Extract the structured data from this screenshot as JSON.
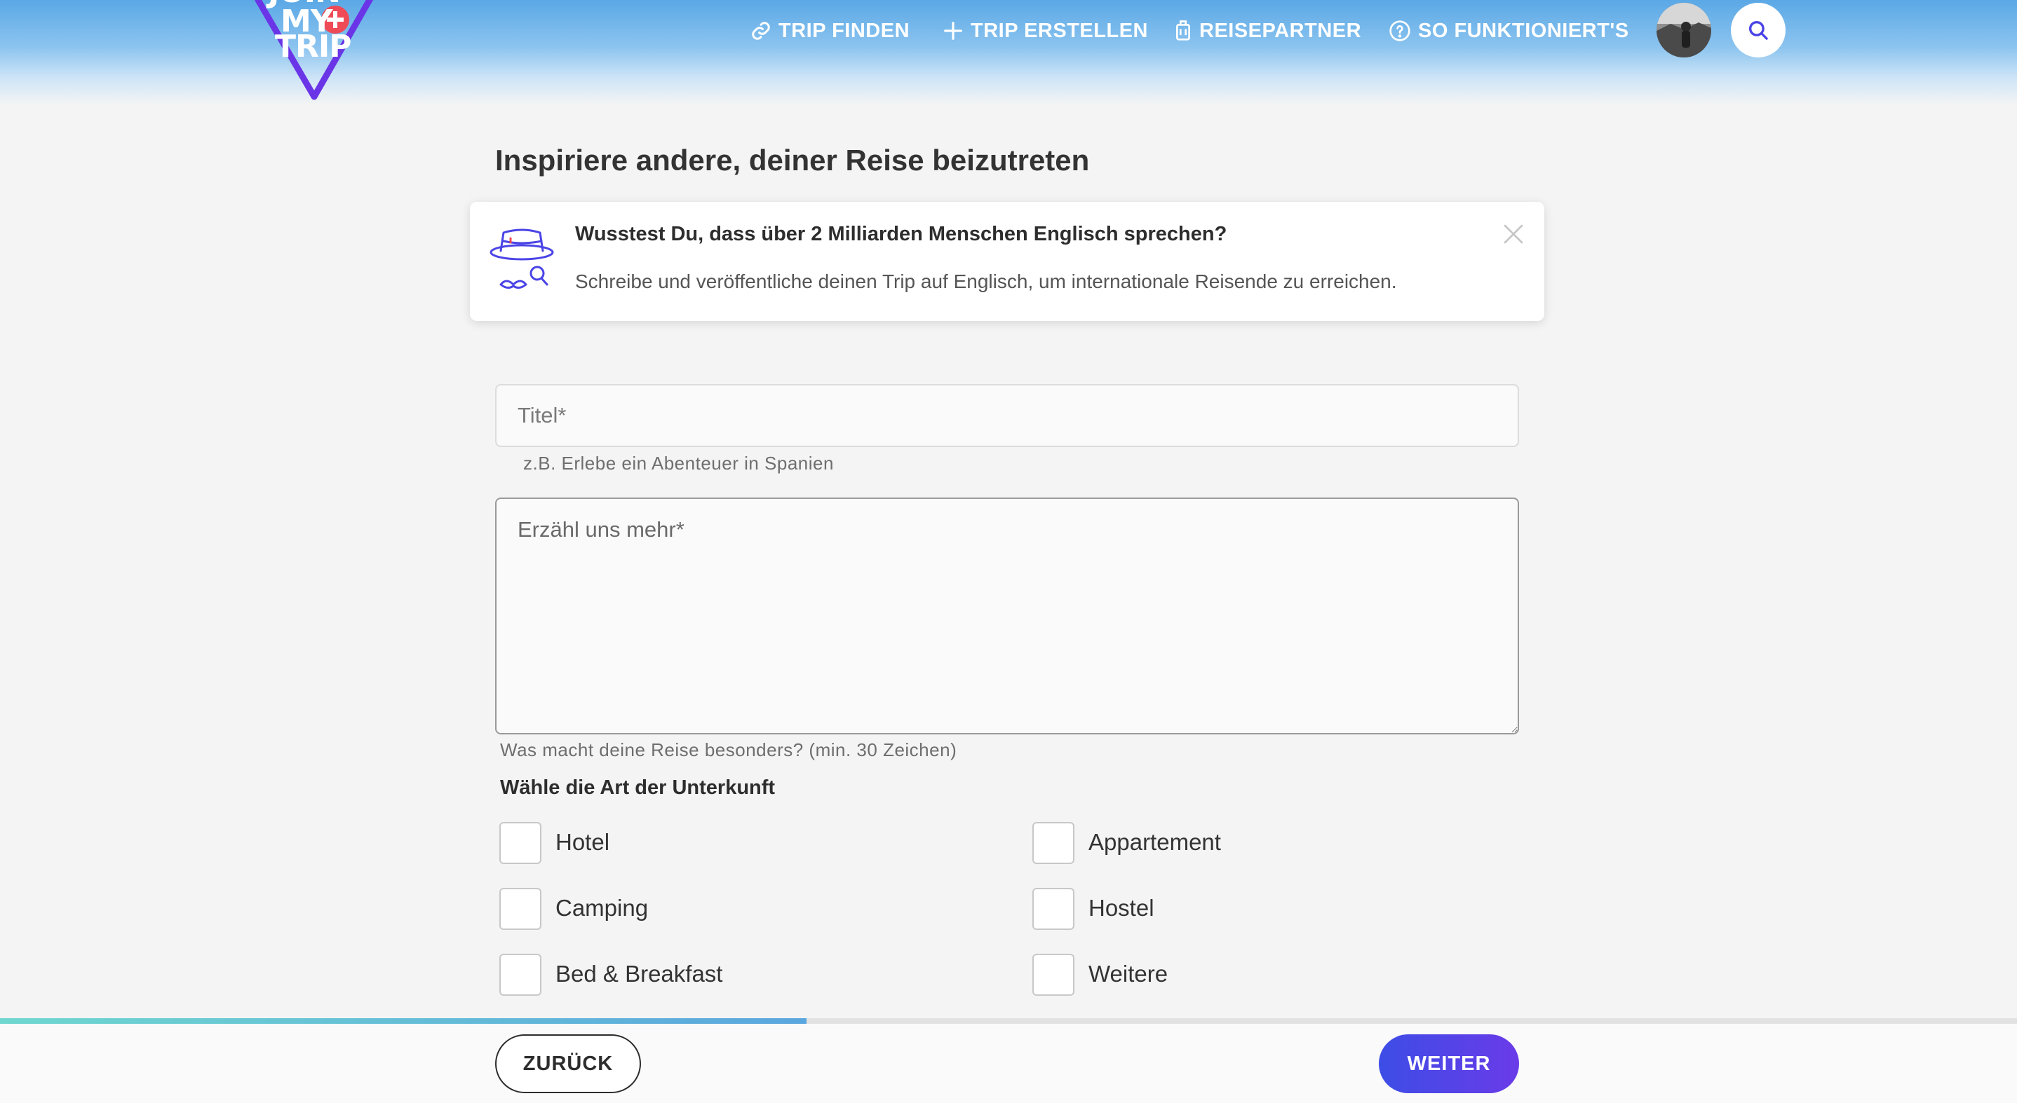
{
  "header": {
    "logo": {
      "line1": "JOIN",
      "line2": "MY",
      "line3": "TRIP"
    },
    "nav": [
      {
        "label": "TRIP FINDEN",
        "icon": "link-icon"
      },
      {
        "label": "TRIP ERSTELLEN",
        "icon": "plus-icon"
      },
      {
        "label": "REISEPARTNER",
        "icon": "luggage-icon"
      },
      {
        "label": "SO FUNKTIONIERT'S",
        "icon": "help-icon"
      }
    ],
    "avatar_icon": "user-avatar",
    "search_icon": "search-icon"
  },
  "page": {
    "title": "Inspiriere andere, deiner Reise beizutreten"
  },
  "info_card": {
    "heading": "Wusstest Du, dass über 2 Milliarden Menschen Englisch sprechen?",
    "body": "Schreibe und veröffentliche deinen Trip auf Englisch, um internationale Reisende zu erreichen.",
    "icon": "detective-hat-icon"
  },
  "form": {
    "title_placeholder": "Titel*",
    "title_value": "",
    "title_hint": "z.B. Erlebe ein Abenteuer in Spanien",
    "description_placeholder": "Erzähl uns mehr*",
    "description_value": "",
    "description_hint": "Was macht deine Reise besonders? (min. 30 Zeichen)",
    "accommodation_label": "Wähle die Art der Unterkunft",
    "accommodation_options": [
      {
        "label": "Hotel",
        "checked": false
      },
      {
        "label": "Appartement",
        "checked": false
      },
      {
        "label": "Camping",
        "checked": false
      },
      {
        "label": "Hostel",
        "checked": false
      },
      {
        "label": "Bed & Breakfast",
        "checked": false
      },
      {
        "label": "Weitere",
        "checked": false
      }
    ]
  },
  "progress": {
    "fraction": 0.4
  },
  "footer": {
    "back_label": "ZURÜCK",
    "next_label": "WEITER"
  },
  "colors": {
    "accent": "#4a44e6",
    "logo_outline": "#6a35e6",
    "logo_plus": "#ef4b57",
    "header_sky": "#5aa8e6",
    "progress_start": "#6fd7cf",
    "progress_end": "#5aa6de"
  }
}
